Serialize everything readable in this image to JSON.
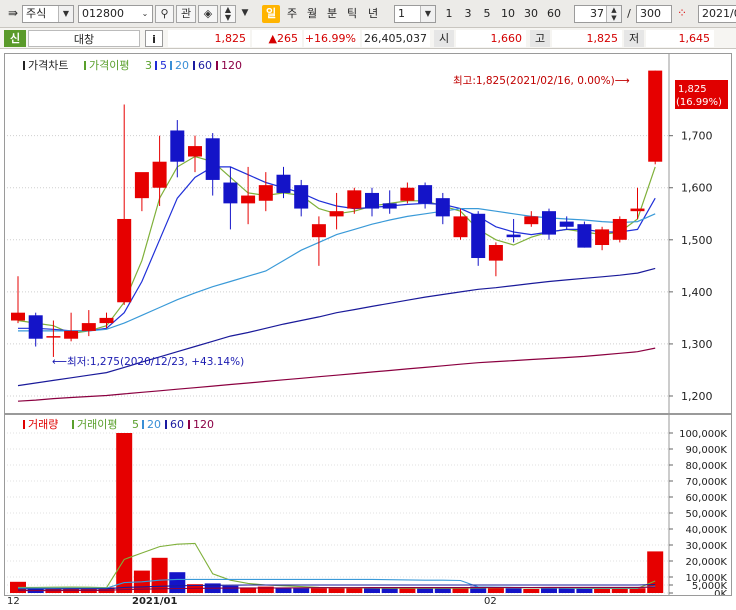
{
  "toolbar": {
    "market": "주식",
    "code": "012800",
    "btn_gwan": "관",
    "periods": [
      "일",
      "주",
      "월",
      "분",
      "틱",
      "년"
    ],
    "unit": "1",
    "minute_buttons": [
      "1",
      "3",
      "5",
      "10",
      "30",
      "60"
    ],
    "count": "37",
    "count_sep": "/",
    "total": "300",
    "date": "2021/0"
  },
  "infobar": {
    "badge": "신",
    "name": "대창",
    "info_icon": "i",
    "price": "1,825",
    "change": "▲265",
    "change_pct": "+16.99%",
    "volume": "26,405,037",
    "open_label": "시",
    "open": "1,660",
    "high_label": "고",
    "high": "1,825",
    "low_label": "저",
    "low": "1,645"
  },
  "price_panel": {
    "legend_title": "가격차트",
    "legend_ma_label": "가격이평",
    "legend_periods": [
      "3",
      "5",
      "20",
      "60",
      "120"
    ],
    "legend_colors": [
      "#5aa02c",
      "#1f2bd6",
      "#3a8fd6",
      "#1a1aa0",
      "#8b0045"
    ],
    "max_annotation": "최고:1,825(2021/02/16, 0.00%)⟶",
    "min_annotation": "⟵최저:1,275(2020/12/23, +43.14%)",
    "current_price_label": "1,825",
    "current_pct_label": "(16.99%)"
  },
  "volume_panel": {
    "legend_title": "거래량",
    "legend_ma_label": "거래이평",
    "legend_periods": [
      "5",
      "20",
      "60",
      "120"
    ]
  },
  "x_axis": {
    "labels": [
      "12",
      "2021/01",
      "02"
    ]
  },
  "colors": {
    "up": "#e60000",
    "down": "#1414c8",
    "ma3": "#7fb03a",
    "ma5": "#2030d8",
    "ma20": "#3a9ad8",
    "ma60": "#1a1a9a",
    "ma120": "#8b0040"
  },
  "chart_data": [
    {
      "type": "candlestick",
      "title": "가격차트",
      "ylim": [
        1175,
        1830
      ],
      "yticks": [
        1200,
        1300,
        1400,
        1500,
        1600,
        1700
      ],
      "candles": [
        {
          "o": 1345,
          "h": 1430,
          "l": 1340,
          "c": 1360
        },
        {
          "o": 1355,
          "h": 1360,
          "l": 1295,
          "c": 1310
        },
        {
          "o": 1315,
          "h": 1345,
          "l": 1275,
          "c": 1315
        },
        {
          "o": 1310,
          "h": 1360,
          "l": 1305,
          "c": 1325
        },
        {
          "o": 1325,
          "h": 1365,
          "l": 1315,
          "c": 1340
        },
        {
          "o": 1340,
          "h": 1360,
          "l": 1330,
          "c": 1350
        },
        {
          "o": 1380,
          "h": 1760,
          "l": 1375,
          "c": 1540
        },
        {
          "o": 1580,
          "h": 1620,
          "l": 1555,
          "c": 1630
        },
        {
          "o": 1600,
          "h": 1700,
          "l": 1565,
          "c": 1650
        },
        {
          "o": 1710,
          "h": 1730,
          "l": 1620,
          "c": 1650
        },
        {
          "o": 1660,
          "h": 1700,
          "l": 1630,
          "c": 1680
        },
        {
          "o": 1695,
          "h": 1705,
          "l": 1585,
          "c": 1615
        },
        {
          "o": 1610,
          "h": 1640,
          "l": 1520,
          "c": 1570
        },
        {
          "o": 1570,
          "h": 1640,
          "l": 1530,
          "c": 1585
        },
        {
          "o": 1575,
          "h": 1630,
          "l": 1555,
          "c": 1605
        },
        {
          "o": 1625,
          "h": 1640,
          "l": 1580,
          "c": 1590
        },
        {
          "o": 1605,
          "h": 1615,
          "l": 1545,
          "c": 1560
        },
        {
          "o": 1505,
          "h": 1545,
          "l": 1450,
          "c": 1530
        },
        {
          "o": 1545,
          "h": 1590,
          "l": 1520,
          "c": 1555
        },
        {
          "o": 1560,
          "h": 1600,
          "l": 1550,
          "c": 1595
        },
        {
          "o": 1590,
          "h": 1600,
          "l": 1545,
          "c": 1560
        },
        {
          "o": 1570,
          "h": 1595,
          "l": 1550,
          "c": 1560
        },
        {
          "o": 1575,
          "h": 1610,
          "l": 1570,
          "c": 1600
        },
        {
          "o": 1605,
          "h": 1610,
          "l": 1560,
          "c": 1570
        },
        {
          "o": 1580,
          "h": 1590,
          "l": 1530,
          "c": 1545
        },
        {
          "o": 1505,
          "h": 1560,
          "l": 1500,
          "c": 1545
        },
        {
          "o": 1550,
          "h": 1555,
          "l": 1450,
          "c": 1465
        },
        {
          "o": 1460,
          "h": 1495,
          "l": 1430,
          "c": 1490
        },
        {
          "o": 1510,
          "h": 1540,
          "l": 1495,
          "c": 1505
        },
        {
          "o": 1530,
          "h": 1555,
          "l": 1525,
          "c": 1545
        },
        {
          "o": 1555,
          "h": 1560,
          "l": 1500,
          "c": 1510
        },
        {
          "o": 1535,
          "h": 1545,
          "l": 1520,
          "c": 1525
        },
        {
          "o": 1530,
          "h": 1535,
          "l": 1485,
          "c": 1485
        },
        {
          "o": 1490,
          "h": 1525,
          "l": 1480,
          "c": 1520
        },
        {
          "o": 1500,
          "h": 1545,
          "l": 1495,
          "c": 1540
        },
        {
          "o": 1555,
          "h": 1600,
          "l": 1540,
          "c": 1560
        },
        {
          "o": 1650,
          "h": 1825,
          "l": 1645,
          "c": 1825
        }
      ],
      "ma": {
        "ma3": [
          1345,
          1340,
          1335,
          1320,
          1325,
          1335,
          1380,
          1460,
          1580,
          1640,
          1660,
          1650,
          1620,
          1590,
          1585,
          1590,
          1585,
          1560,
          1550,
          1555,
          1565,
          1570,
          1575,
          1575,
          1565,
          1555,
          1520,
          1500,
          1490,
          1505,
          1515,
          1520,
          1515,
          1510,
          1515,
          1540,
          1640
        ],
        "ma5": [
          1330,
          1330,
          1328,
          1325,
          1325,
          1330,
          1360,
          1420,
          1500,
          1580,
          1620,
          1640,
          1640,
          1625,
          1610,
          1600,
          1590,
          1575,
          1565,
          1560,
          1562,
          1565,
          1568,
          1570,
          1568,
          1560,
          1545,
          1525,
          1515,
          1510,
          1515,
          1520,
          1520,
          1515,
          1515,
          1520,
          1580
        ],
        "ma20": [
          1325,
          1325,
          1325,
          1325,
          1325,
          1328,
          1340,
          1355,
          1370,
          1385,
          1398,
          1410,
          1420,
          1430,
          1440,
          1460,
          1480,
          1495,
          1510,
          1520,
          1530,
          1538,
          1545,
          1550,
          1555,
          1560,
          1560,
          1555,
          1550,
          1545,
          1542,
          1540,
          1538,
          1535,
          1533,
          1535,
          1550
        ],
        "ma60": [
          1220,
          1225,
          1230,
          1235,
          1240,
          1245,
          1255,
          1265,
          1275,
          1285,
          1295,
          1305,
          1315,
          1322,
          1330,
          1338,
          1345,
          1352,
          1360,
          1366,
          1372,
          1378,
          1384,
          1390,
          1395,
          1400,
          1405,
          1408,
          1412,
          1416,
          1420,
          1423,
          1426,
          1429,
          1432,
          1436,
          1445
        ],
        "ma120": [
          1190,
          1192,
          1195,
          1197,
          1199,
          1201,
          1204,
          1207,
          1210,
          1213,
          1216,
          1219,
          1222,
          1225,
          1228,
          1231,
          1234,
          1237,
          1240,
          1243,
          1246,
          1249,
          1252,
          1255,
          1258,
          1261,
          1264,
          1266,
          1268,
          1270,
          1272,
          1274,
          1276,
          1279,
          1282,
          1285,
          1292
        ]
      }
    },
    {
      "type": "bar",
      "title": "거래량",
      "unit": "K",
      "ylim": [
        0,
        100000
      ],
      "yticks": [
        0,
        5000,
        10000,
        20000,
        30000,
        40000,
        50000,
        60000,
        70000,
        80000,
        90000,
        100000
      ],
      "ytick_labels": [
        "0K",
        "5,000K",
        "10,000K",
        "20,000K",
        "30,000K",
        "40,000K",
        "50,000K",
        "60,000K",
        "70,000K",
        "80,000K",
        "90,000K",
        "100,000K"
      ],
      "values": [
        7000,
        3000,
        3000,
        2500,
        3000,
        3500,
        100000,
        14000,
        22000,
        13000,
        5500,
        6000,
        4500,
        3500,
        4000,
        3000,
        3000,
        3000,
        3000,
        3000,
        3000,
        3000,
        3000,
        3000,
        3000,
        3000,
        4000,
        3500,
        3000,
        2500,
        3000,
        3000,
        3000,
        2500,
        3000,
        3000,
        26000
      ],
      "ma5": [
        3500,
        3500,
        3600,
        3700,
        3600,
        3300,
        21000,
        25000,
        29000,
        30500,
        31000,
        12000,
        8000,
        6000,
        5000,
        4500,
        4000,
        3500,
        3300,
        3200,
        3100,
        3000,
        3000,
        3000,
        3000,
        3000,
        3200,
        3300,
        3300,
        3200,
        3100,
        3000,
        2900,
        2900,
        2900,
        2900,
        7500
      ],
      "ma20": [
        3000,
        3000,
        3000,
        3000,
        3000,
        3000,
        6500,
        7000,
        8000,
        8500,
        8500,
        8500,
        8500,
        8500,
        8500,
        8500,
        8500,
        8500,
        8500,
        8500,
        8500,
        8300,
        8200,
        8000,
        8000,
        7800,
        3800,
        3600,
        3500,
        3400,
        3300,
        3200,
        3200,
        3100,
        3100,
        3100,
        4200
      ],
      "ma60": [
        2500,
        2500,
        2500,
        2600,
        2600,
        2600,
        3500,
        3800,
        4200,
        4500,
        4700,
        4800,
        4900,
        5000,
        5000,
        5000,
        5000,
        5000,
        5000,
        5000,
        5000,
        5000,
        5000,
        5000,
        5000,
        5000,
        5000,
        5000,
        5000,
        5000,
        5000,
        5000,
        5000,
        5000,
        5000,
        5000,
        5300
      ],
      "ma120": [
        1500,
        1500,
        1500,
        1600,
        1600,
        1600,
        2200,
        2400,
        2600,
        2800,
        2900,
        3000,
        3050,
        3100,
        3150,
        3200,
        3250,
        3300,
        3300,
        3300,
        3350,
        3350,
        3400,
        3400,
        3400,
        3400,
        3450,
        3450,
        3450,
        3450,
        3500,
        3500,
        3500,
        3500,
        3500,
        3500,
        3700
      ]
    }
  ]
}
